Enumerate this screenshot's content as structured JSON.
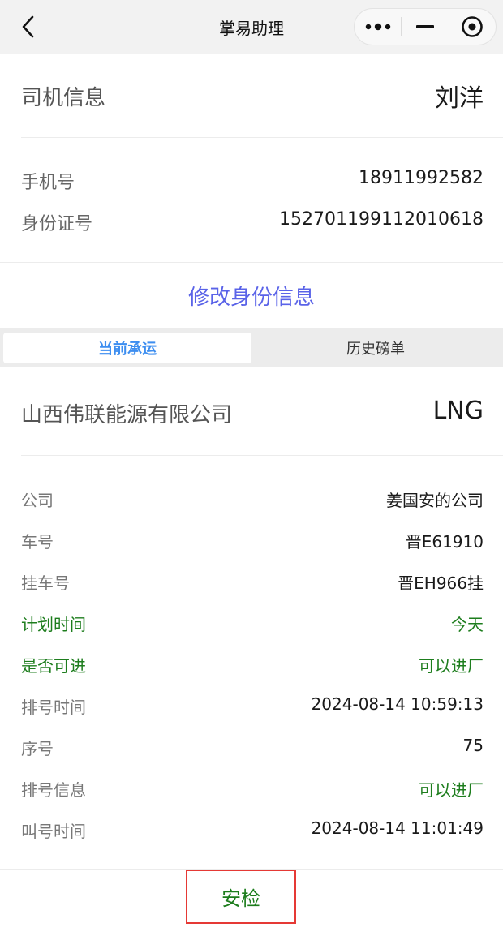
{
  "nav": {
    "title": "掌易助理",
    "back_icon": "chevron-left-icon",
    "more_icon": "more-dots-icon",
    "minimize_icon": "minus-icon",
    "close_icon": "target-circle-icon"
  },
  "driver": {
    "label": "司机信息",
    "name": "刘洋",
    "phone_label": "手机号",
    "phone": "18911992582",
    "id_label": "身份证号",
    "id_number": "152701199112010618",
    "edit_link": "修改身份信息"
  },
  "tabs": [
    {
      "label": "当前承运",
      "active": true
    },
    {
      "label": "历史磅单",
      "active": false
    }
  ],
  "order": {
    "company_name": "山西伟联能源有限公司",
    "cargo_type": "LNG",
    "rows": [
      {
        "key": "公司",
        "value": "姜国安的公司",
        "key_green": false,
        "value_green": false
      },
      {
        "key": "车号",
        "value": "晋E61910",
        "key_green": false,
        "value_green": false
      },
      {
        "key": "挂车号",
        "value": "晋EH966挂",
        "key_green": false,
        "value_green": false
      },
      {
        "key": "计划时间",
        "value": "今天",
        "key_green": true,
        "value_green": true
      },
      {
        "key": "是否可进",
        "value": "可以进厂",
        "key_green": true,
        "value_green": true
      },
      {
        "key": "排号时间",
        "value": "2024-08-14 10:59:13",
        "key_green": false,
        "value_green": false
      },
      {
        "key": "序号",
        "value": "75",
        "key_green": false,
        "value_green": false
      },
      {
        "key": "排号信息",
        "value": "可以进厂",
        "key_green": false,
        "value_green": true
      },
      {
        "key": "叫号时间",
        "value": "2024-08-14 11:01:49",
        "key_green": false,
        "value_green": false
      }
    ]
  },
  "actions": {
    "safety_check": "安检"
  },
  "colors": {
    "link": "#5a63e8",
    "tab_active": "#3d8ef0",
    "green": "#1d7d1d",
    "highlight_border": "#e53935"
  }
}
